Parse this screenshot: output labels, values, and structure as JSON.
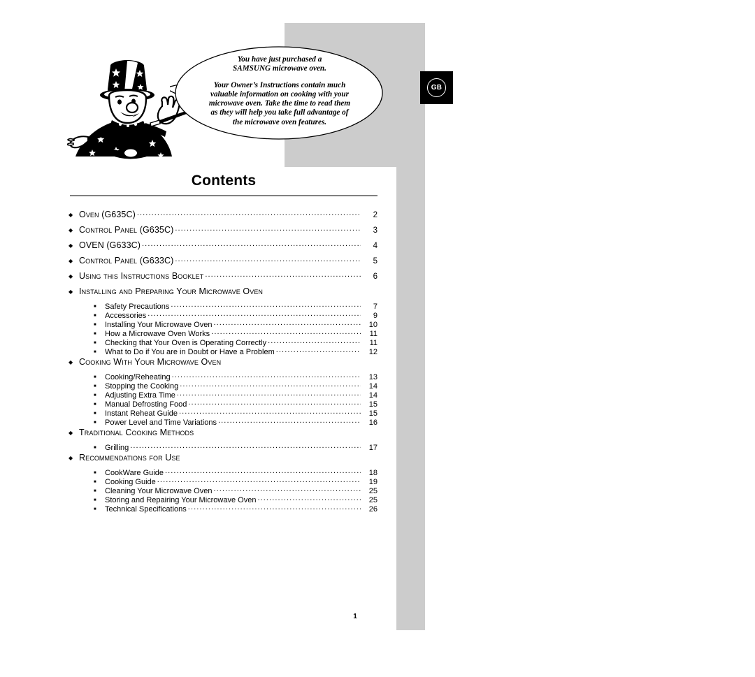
{
  "document": {
    "language_badge": "GB",
    "page_number": "1"
  },
  "speech_bubble": {
    "paragraph1_line1": "You have just purchased a",
    "paragraph1_line2": "SAMSUNG microwave oven.",
    "paragraph2_line1": "Your Owner’s Instructions contain much",
    "paragraph2_line2": "valuable information on cooking with your",
    "paragraph2_line3": "microwave oven. Take the time to read them",
    "paragraph2_line4": "as they will help you take full advantage of",
    "paragraph2_line5": "the microwave oven features."
  },
  "contents": {
    "heading": "Contents",
    "entries": [
      {
        "type": "major",
        "label": "Oven (G635C)",
        "page": "2",
        "leader": true,
        "allcaps": false
      },
      {
        "type": "major",
        "label": "Control Panel (G635C)",
        "page": "3",
        "leader": true,
        "allcaps": false
      },
      {
        "type": "major",
        "label": "OVEN (G633C)",
        "page": "4",
        "leader": true,
        "allcaps": true
      },
      {
        "type": "major",
        "label": "Control Panel (G633C)",
        "page": "5",
        "leader": true,
        "allcaps": false
      },
      {
        "type": "major",
        "label": "Using this Instructions Booklet",
        "page": "6",
        "leader": true,
        "allcaps": false
      },
      {
        "type": "major",
        "label": "Installing and Preparing Your Microwave Oven",
        "page": "",
        "leader": false,
        "allcaps": false
      },
      {
        "type": "sub",
        "label": "Safety Precautions",
        "page": "7",
        "leader": true
      },
      {
        "type": "sub",
        "label": "Accessories",
        "page": "9",
        "leader": true
      },
      {
        "type": "sub",
        "label": "Installing Your Microwave Oven",
        "page": "10",
        "leader": true
      },
      {
        "type": "sub",
        "label": "How a Microwave Oven Works",
        "page": "11",
        "leader": true
      },
      {
        "type": "sub",
        "label": "Checking that Your Oven is Operating Correctly",
        "page": "11",
        "leader": true
      },
      {
        "type": "sub",
        "label": "What to Do if You are in Doubt or Have a Problem",
        "page": "12",
        "leader": true
      },
      {
        "type": "major",
        "label": "Cooking With Your Microwave Oven",
        "page": "",
        "leader": false,
        "allcaps": false
      },
      {
        "type": "sub",
        "label": "Cooking/Reheating",
        "page": "13",
        "leader": true
      },
      {
        "type": "sub",
        "label": "Stopping the Cooking",
        "page": "14",
        "leader": true
      },
      {
        "type": "sub",
        "label": "Adjusting Extra Time",
        "page": "14",
        "leader": true
      },
      {
        "type": "sub",
        "label": "Manual Defrosting Food",
        "page": "15",
        "leader": true
      },
      {
        "type": "sub",
        "label": "Instant Reheat Guide",
        "page": "15",
        "leader": true
      },
      {
        "type": "sub",
        "label": "Power Level and Time Variations",
        "page": "16",
        "leader": true
      },
      {
        "type": "major",
        "label": "Traditional Cooking Methods",
        "page": "",
        "leader": false,
        "allcaps": false
      },
      {
        "type": "sub",
        "label": "Grilling",
        "page": "17",
        "leader": true
      },
      {
        "type": "major",
        "label": "Recommendations for Use",
        "page": "",
        "leader": false,
        "allcaps": false
      },
      {
        "type": "sub",
        "label": "CookWare Guide",
        "page": "18",
        "leader": true
      },
      {
        "type": "sub",
        "label": "Cooking Guide",
        "page": "19",
        "leader": true
      },
      {
        "type": "sub",
        "label": "Cleaning Your Microwave Oven",
        "page": "25",
        "leader": true
      },
      {
        "type": "sub",
        "label": "Storing and Repairing Your Microwave Oven",
        "page": "25",
        "leader": true
      },
      {
        "type": "sub",
        "label": "Technical Specifications",
        "page": "26",
        "leader": true
      }
    ]
  },
  "icons": {
    "major_bullet": "◆",
    "sub_bullet": "■"
  },
  "colors": {
    "panel_gray": "#cccccc",
    "rule_gray": "#808080",
    "badge_black": "#000000",
    "page_white": "#ffffff"
  }
}
